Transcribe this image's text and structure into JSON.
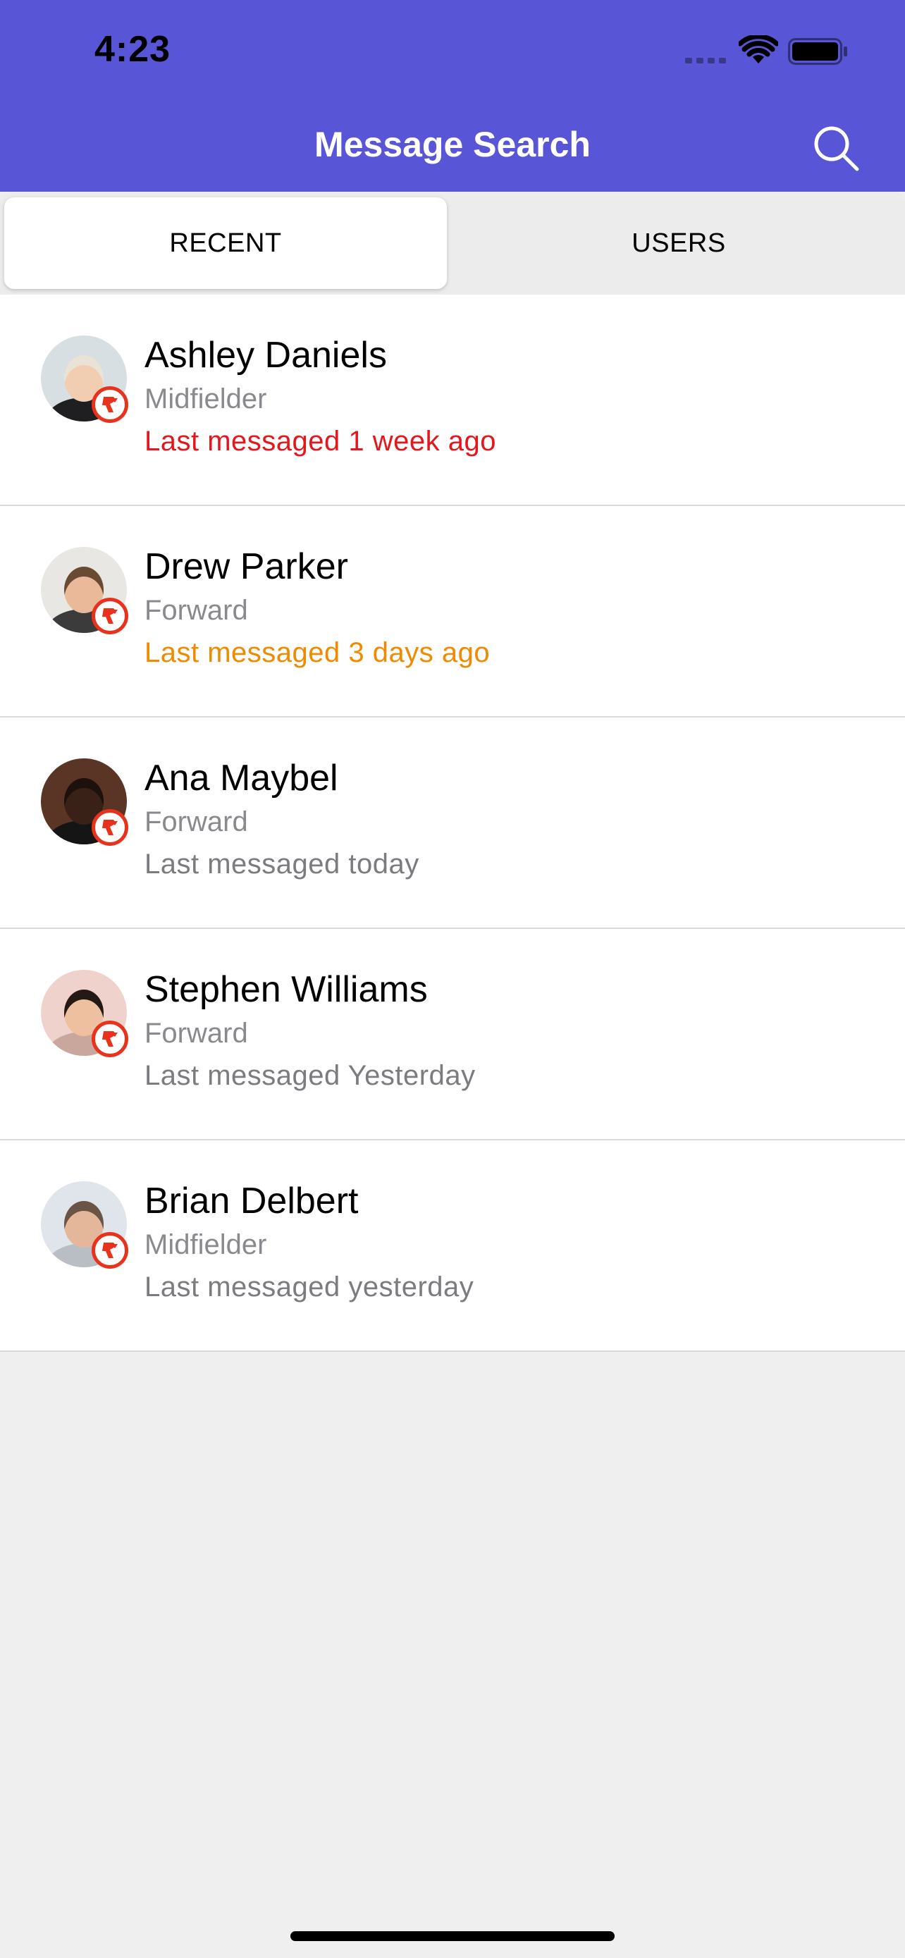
{
  "status_bar": {
    "time": "4:23",
    "signal_icon": "signal-dots-icon",
    "wifi_icon": "wifi-icon",
    "battery_icon": "battery-icon"
  },
  "header": {
    "title": "Message Search",
    "search_icon": "search-icon",
    "background_color": "#5856d6"
  },
  "tabs": [
    {
      "label": "RECENT",
      "selected": true
    },
    {
      "label": "USERS",
      "selected": false
    }
  ],
  "contacts": [
    {
      "name": "Ashley Daniels",
      "position": "Midfielder",
      "last_messaged": "Last messaged 1 week ago",
      "last_messaged_color": "#e3171d",
      "avatar": {
        "bg": "#d8dfe2",
        "skin": "#f1cdb2",
        "hair": "#e9e3d6",
        "top": "#1f1f22"
      }
    },
    {
      "name": "Drew Parker",
      "position": "Forward",
      "last_messaged": "Last messaged 3 days ago",
      "last_messaged_color": "#f08a00",
      "avatar": {
        "bg": "#e9e7e4",
        "skin": "#e9b99a",
        "hair": "#6b4a33",
        "top": "#3b3b3b"
      }
    },
    {
      "name": "Ana Maybel",
      "position": "Forward",
      "last_messaged": "Last messaged today",
      "last_messaged_color": "#7b7b80",
      "avatar": {
        "bg": "#5a3424",
        "skin": "#3a2117",
        "hair": "#1c110c",
        "top": "#151515"
      }
    },
    {
      "name": "Stephen Williams",
      "position": "Forward",
      "last_messaged": "Last messaged Yesterday",
      "last_messaged_color": "#7b7b80",
      "avatar": {
        "bg": "#f0d2cc",
        "skin": "#efc09f",
        "hair": "#231a16",
        "top": "#c9a79c"
      }
    },
    {
      "name": "Brian Delbert",
      "position": "Midfielder",
      "last_messaged": "Last messaged yesterday",
      "last_messaged_color": "#7b7b80",
      "avatar": {
        "bg": "#dfe5ea",
        "skin": "#e5b79a",
        "hair": "#6a5446",
        "top": "#b9bec4"
      }
    }
  ],
  "badge_icon": "team-logo-icon",
  "badge_color": "#e8321c"
}
